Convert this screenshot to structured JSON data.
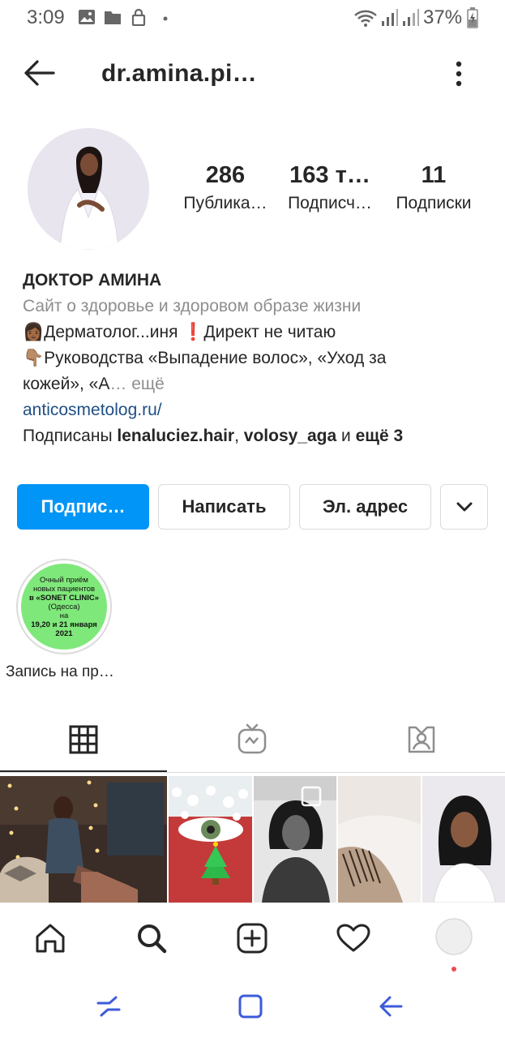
{
  "status_bar": {
    "time": "3:09",
    "battery": "37%"
  },
  "header": {
    "username": "dr.amina.pi…"
  },
  "stats": [
    {
      "value": "286",
      "label": "Публика…"
    },
    {
      "value": "163 т…",
      "label": "Подписч…"
    },
    {
      "value": "11",
      "label": "Подписки"
    }
  ],
  "bio": {
    "name": "ДОКТОР АМИНА",
    "category": "Сайт о здоровье и здоровом образе жизни",
    "line1": "👩🏾Дерматолог...иня ❗Директ не читаю",
    "line2": "👇🏽Руководства «Выпадение волос», «Уход за",
    "line3": "кожей», «А",
    "more": "… ещё",
    "link": "anticosmetolog.ru/",
    "followed_prefix": "Подписаны ",
    "followed_user1": "lenaluciez.hair",
    "followed_sep": ", ",
    "followed_user2": "volosy_aga",
    "followed_and": " и ",
    "followed_more": "ещё 3"
  },
  "buttons": {
    "follow": "Подпис…",
    "message": "Написать",
    "email": "Эл. адрес"
  },
  "highlight": {
    "text_lines": [
      "Очный приём",
      "новых пациентов",
      "в «SONET CLINIC»",
      "(Одесса)",
      "на",
      "19,20 и 21 января",
      "2021"
    ],
    "label": "Запись на пр…"
  },
  "colors": {
    "accent": "#0095f6",
    "link": "#1f4f86",
    "muted": "#8e8e8e",
    "highlight_bg": "#7fe87a",
    "notification_dot": "#ed4956",
    "system_nav": "#3d5bd9"
  }
}
